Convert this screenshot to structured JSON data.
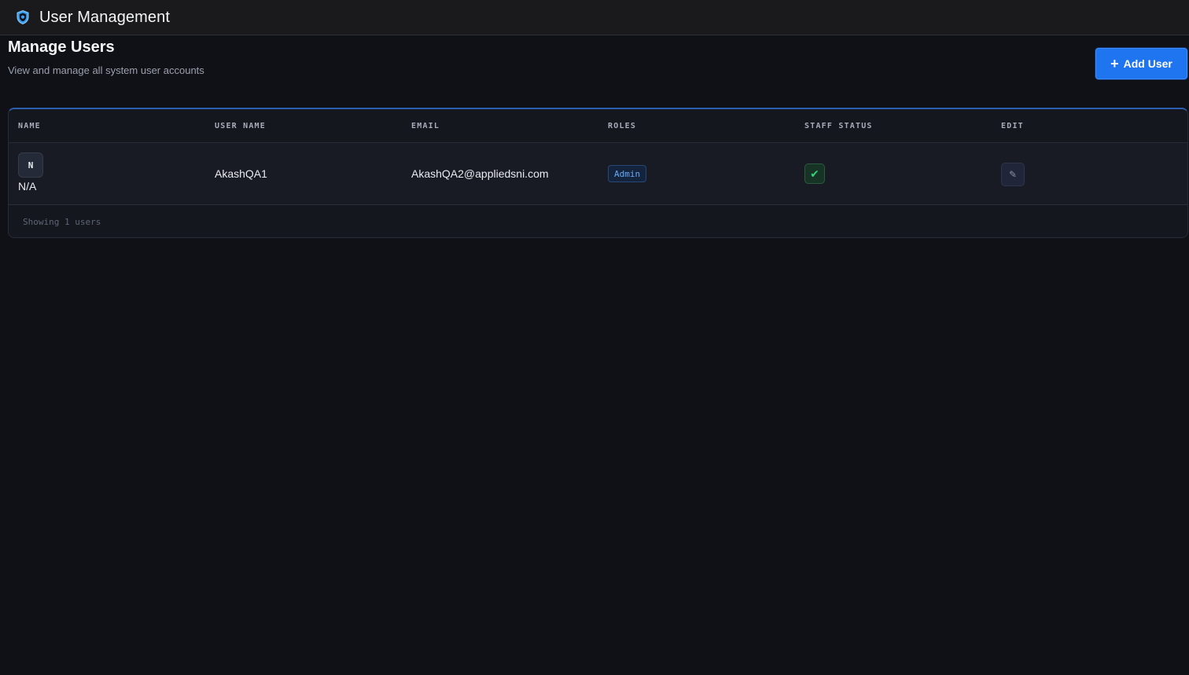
{
  "app": {
    "title": "User Management",
    "logo_icon": "shield-icon"
  },
  "page": {
    "title": "Manage Users",
    "subtitle": "View and manage all system user accounts"
  },
  "actions": {
    "add_user_label": "Add User",
    "add_user_icon": "plus-icon",
    "accent_color": "#1f74f0"
  },
  "table": {
    "columns": [
      "NAME",
      "USER NAME",
      "EMAIL",
      "ROLES",
      "STAFF STATUS",
      "EDIT"
    ],
    "rows": [
      {
        "avatar_initial": "N",
        "name": "N/A",
        "username": "AkashQA1",
        "email": "AkashQA2@appliedsni.com",
        "role": "Admin",
        "staff_status_icon": "check-icon",
        "staff_status_glyph": "✔",
        "edit_icon": "pencil-icon",
        "edit_glyph": "✎"
      }
    ],
    "footer": "Showing 1 users"
  }
}
